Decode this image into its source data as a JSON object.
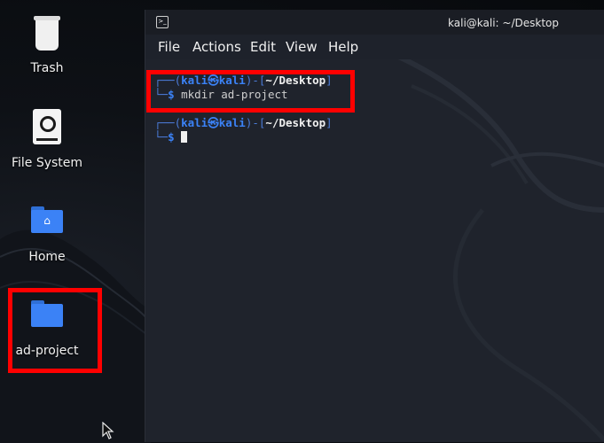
{
  "desktop": {
    "icons": [
      {
        "label": "Trash",
        "icon": "trash-icon"
      },
      {
        "label": "File System",
        "icon": "drive-icon"
      },
      {
        "label": "Home",
        "icon": "home-folder-icon"
      },
      {
        "label": "ad-project",
        "icon": "folder-icon"
      }
    ]
  },
  "terminal": {
    "title": "kali@kali: ~/Desktop",
    "menu": [
      "File",
      "Actions",
      "Edit",
      "View",
      "Help"
    ],
    "prompt_user": "kali",
    "prompt_sep": "㉿",
    "prompt_host": "kali",
    "prompt_dir": "~/Desktop",
    "prompt_symbol": "$",
    "commands": [
      "mkdir ad-project",
      ""
    ]
  },
  "colors": {
    "highlight": "#ff0000",
    "folder": "#3b82f6",
    "prompt": "#3b82f6"
  }
}
